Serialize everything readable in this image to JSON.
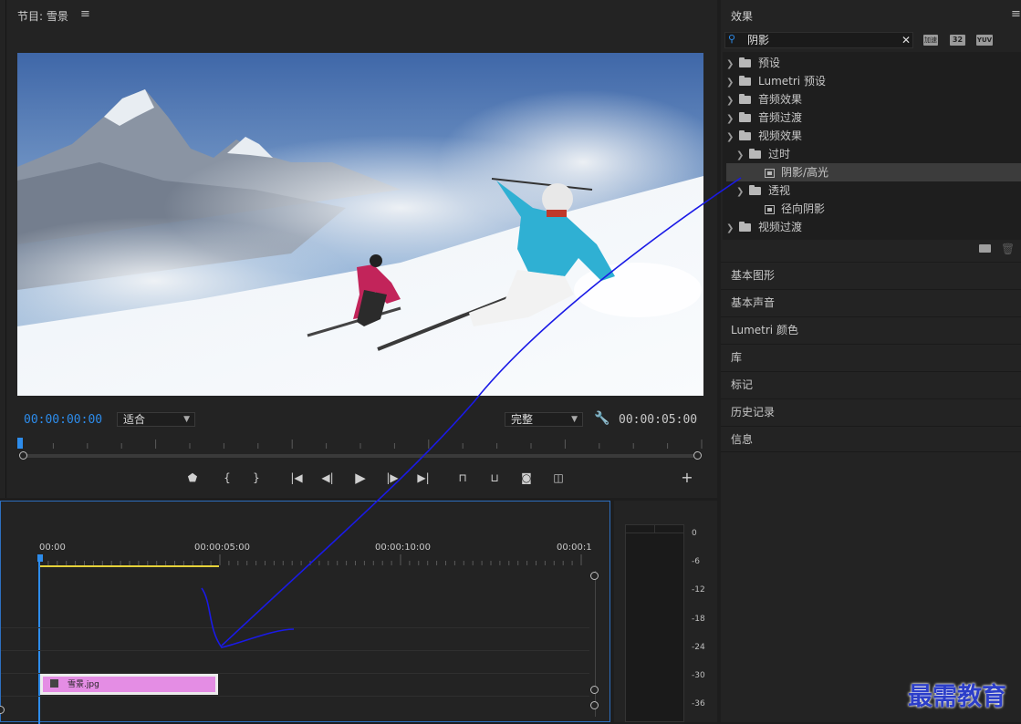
{
  "program_monitor": {
    "title": "节目: 雪景",
    "menu_icon": "hamburger-icon",
    "current_timecode": "00:00:00:00",
    "fit_select": "适合",
    "quality_select": "完整",
    "duration_timecode": "00:00:05:00",
    "wrench_icon": "wrench-icon",
    "controls": [
      "marker-icon",
      "mark-in-icon",
      "mark-out-icon",
      "go-to-in-icon",
      "step-back-icon",
      "play-icon",
      "step-forward-icon",
      "go-to-out-icon",
      "lift-icon",
      "extract-icon",
      "camera-icon",
      "compare-icon",
      "add-icon"
    ]
  },
  "effects_panel": {
    "title": "效果",
    "search_value": "阴影",
    "badge_accelerated": "加速",
    "badge_32": "32",
    "badge_yuv": "YUV",
    "tree": [
      {
        "label": "预设",
        "type": "folder",
        "expanded": false,
        "level": 0
      },
      {
        "label": "Lumetri 预设",
        "type": "folder",
        "expanded": false,
        "level": 0
      },
      {
        "label": "音频效果",
        "type": "folder",
        "expanded": false,
        "level": 0
      },
      {
        "label": "音频过渡",
        "type": "folder",
        "expanded": false,
        "level": 0
      },
      {
        "label": "视频效果",
        "type": "folder",
        "expanded": true,
        "level": 0
      },
      {
        "label": "过时",
        "type": "folder",
        "expanded": true,
        "level": 1
      },
      {
        "label": "阴影/高光",
        "type": "effect",
        "level": 2,
        "selected": true
      },
      {
        "label": "透视",
        "type": "folder",
        "expanded": true,
        "level": 1
      },
      {
        "label": "径向阴影",
        "type": "effect",
        "level": 2
      },
      {
        "label": "视频过渡",
        "type": "folder",
        "expanded": false,
        "level": 0
      }
    ],
    "sections": [
      "基本图形",
      "基本声音",
      "Lumetri 颜色",
      "库",
      "标记",
      "历史记录",
      "信息"
    ]
  },
  "timeline": {
    "ruler": [
      "00:00",
      "00:00:05:00",
      "00:00:10:00",
      "00:00:1"
    ],
    "clip_label": "雪景.jpg",
    "clip_color": "#e48de4"
  },
  "audio_meter": {
    "scale": [
      "0",
      "-6",
      "-12",
      "-18",
      "-24",
      "-30",
      "-36"
    ]
  },
  "watermark": "最需教育"
}
